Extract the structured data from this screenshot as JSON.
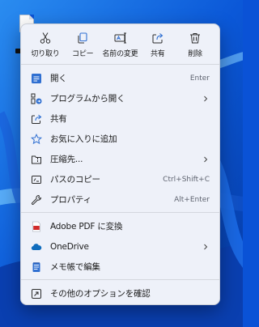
{
  "toolbar": [
    {
      "label": "切り取り",
      "icon": "scissors-icon"
    },
    {
      "label": "コピー",
      "icon": "copy-icon"
    },
    {
      "label": "名前の変更",
      "icon": "rename-icon"
    },
    {
      "label": "共有",
      "icon": "share-icon"
    },
    {
      "label": "削除",
      "icon": "trash-icon"
    }
  ],
  "items": {
    "open": {
      "label": "開く",
      "shortcut": "Enter",
      "icon": "app-icon"
    },
    "open_with": {
      "label": "プログラムから開く",
      "icon": "open-with-icon"
    },
    "share": {
      "label": "共有",
      "icon": "share-icon"
    },
    "favorite": {
      "label": "お気に入りに追加",
      "icon": "star-icon"
    },
    "compress": {
      "label": "圧縮先...",
      "icon": "folder-zip-icon"
    },
    "copy_path": {
      "label": "パスのコピー",
      "shortcut": "Ctrl+Shift+C",
      "icon": "path-icon"
    },
    "properties": {
      "label": "プロパティ",
      "shortcut": "Alt+Enter",
      "icon": "wrench-icon"
    },
    "adobe_pdf": {
      "label": "Adobe PDF に変換",
      "icon": "pdf-icon"
    },
    "onedrive": {
      "label": "OneDrive",
      "icon": "cloud-icon"
    },
    "notepad": {
      "label": "メモ帳で編集",
      "icon": "notepad-icon"
    },
    "more_options": {
      "label": "その他のオプションを確認",
      "icon": "more-options-icon"
    }
  },
  "colors": {
    "accent": "#2f6fd1",
    "pdf_red": "#d12b2b",
    "onedrive_blue": "#0f6cbd",
    "menu_bg": "#eef1f9"
  }
}
